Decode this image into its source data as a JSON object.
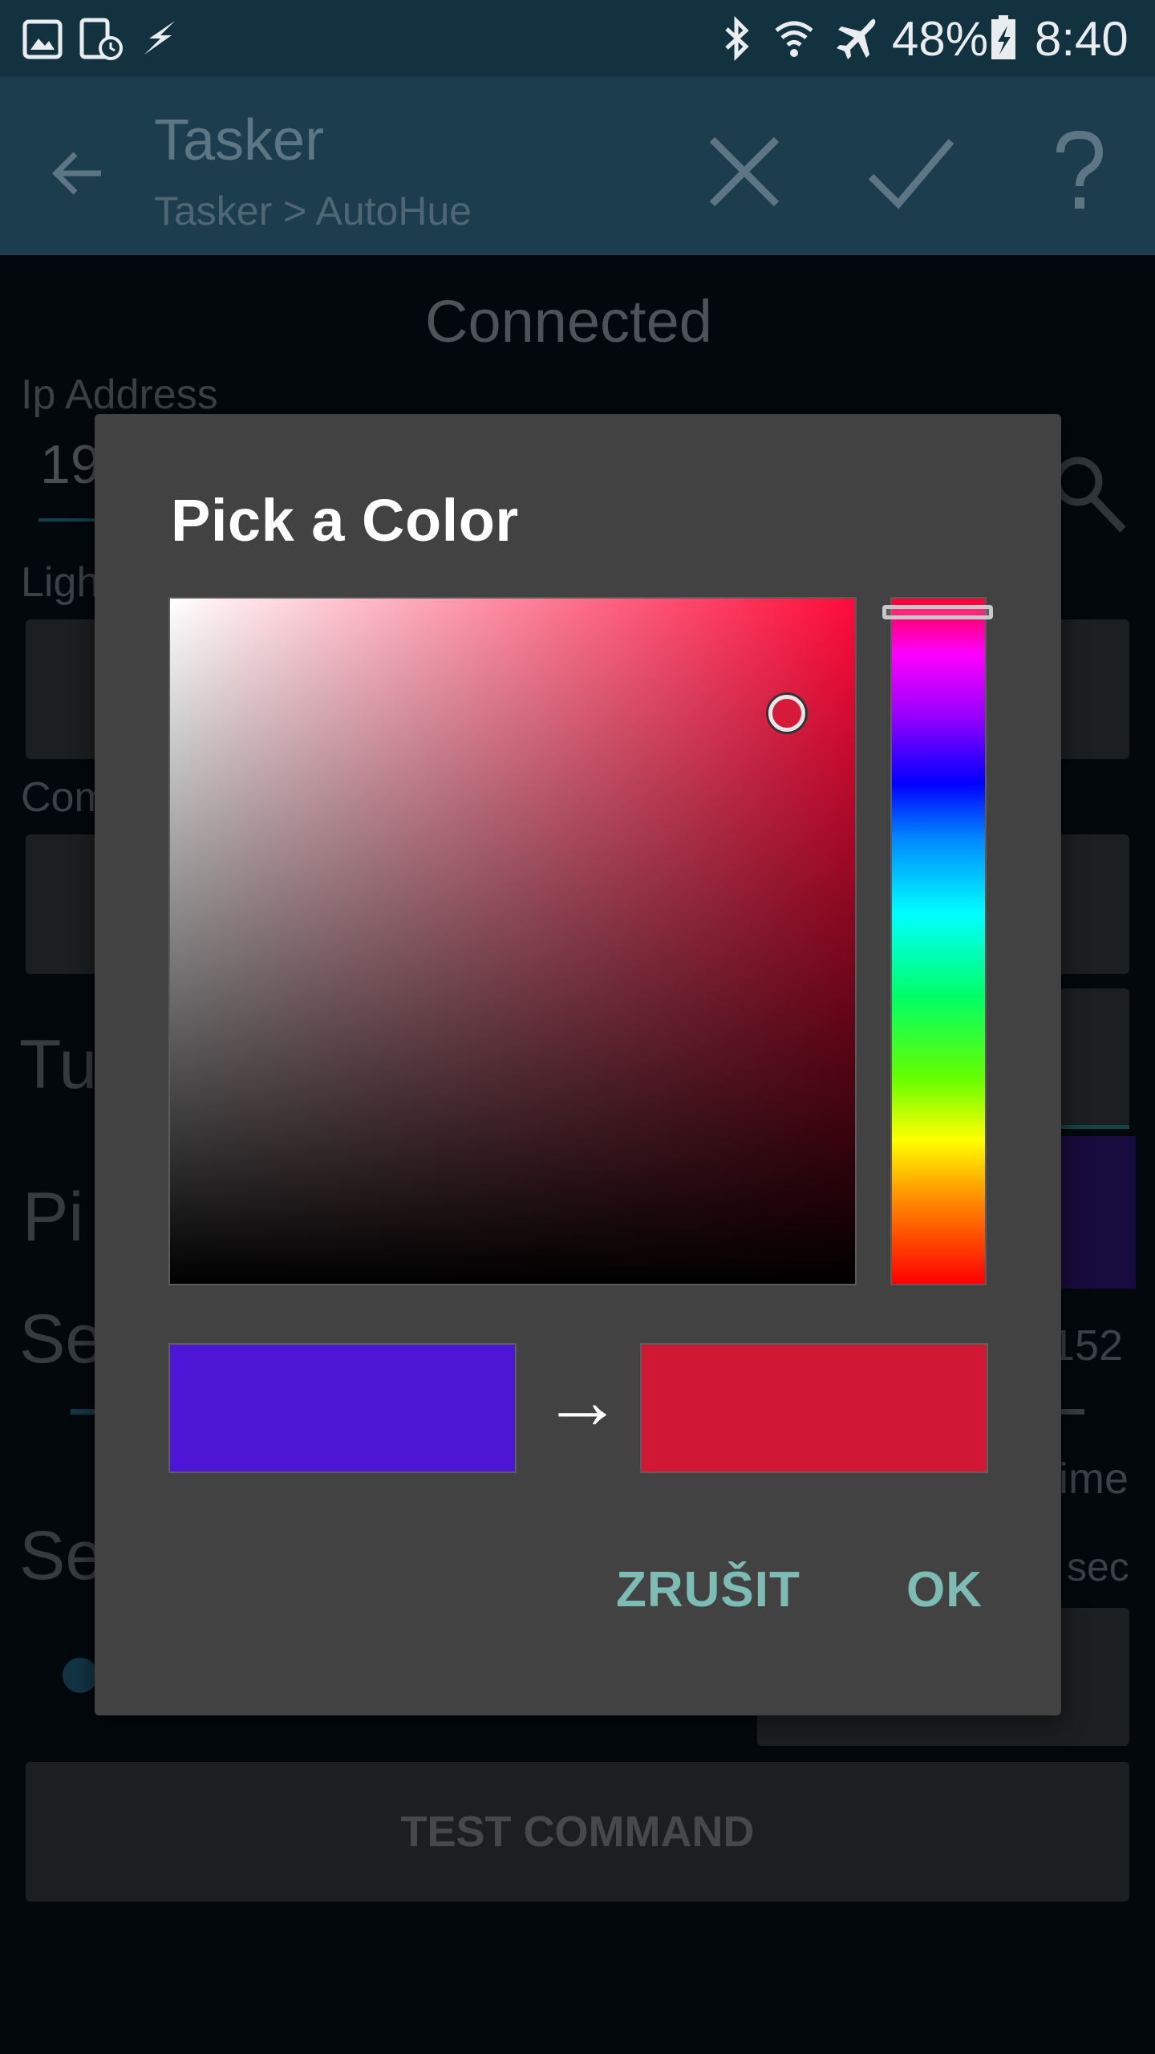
{
  "status_bar": {
    "battery_text": "48%",
    "time": "8:40",
    "icons": [
      "gallery-icon",
      "screenshot-timer-icon",
      "flash-icon",
      "bluetooth-icon",
      "wifi-icon",
      "airplane-mode-icon",
      "battery-charging-icon"
    ]
  },
  "toolbar": {
    "title": "Tasker",
    "subtitle": "Tasker > AutoHue",
    "icons": [
      "back-arrow-icon",
      "close-icon",
      "check-icon",
      "help-icon"
    ]
  },
  "background_page": {
    "status": "Connected",
    "ip_label": "Ip Address",
    "ip_value_partial": "19",
    "lights_label_partial": "Ligh",
    "command_label_partial": "Com",
    "tu_partial": "Tu",
    "pi_partial": "Pi",
    "se_partial_1": "Se",
    "se_partial_2": "Se",
    "value_152": "152",
    "time_partial": "ime",
    "sec_partial": "sec",
    "test_command": "TEST COMMAND"
  },
  "dialog": {
    "title": "Pick a Color",
    "old_color": "#4c16d4",
    "new_color": "#d01834",
    "hue_color": "#ff0b3a",
    "arrow": "→",
    "cancel_label": "ZRUŠIT",
    "ok_label": "OK"
  }
}
